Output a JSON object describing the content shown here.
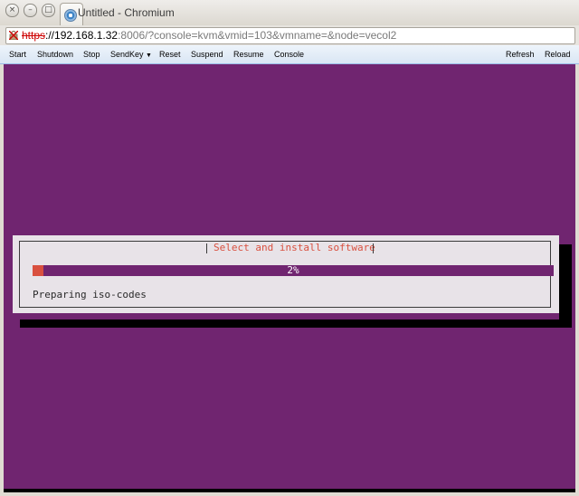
{
  "window": {
    "title": "Untitled - Chromium"
  },
  "tab": {
    "favicon": "chromium-icon"
  },
  "address": {
    "scheme": "https",
    "host": "://192.168.1.32",
    "rest": ":8006/?console=kvm&vmid=103&vmname=&node=vecol2"
  },
  "toolbar": {
    "start": "Start",
    "shutdown": "Shutdown",
    "stop": "Stop",
    "sendkey": "SendKey",
    "reset": "Reset",
    "suspend": "Suspend",
    "resume": "Resume",
    "console": "Console",
    "refresh": "Refresh",
    "reload": "Reload"
  },
  "installer": {
    "title": "Select and install software",
    "progress_percent": 2,
    "progress_label": "2%",
    "status": "Preparing iso-codes"
  },
  "colors": {
    "console_bg": "#702570",
    "progress_fill": "#d9503f",
    "dialog_bg": "#e8e3e8"
  }
}
